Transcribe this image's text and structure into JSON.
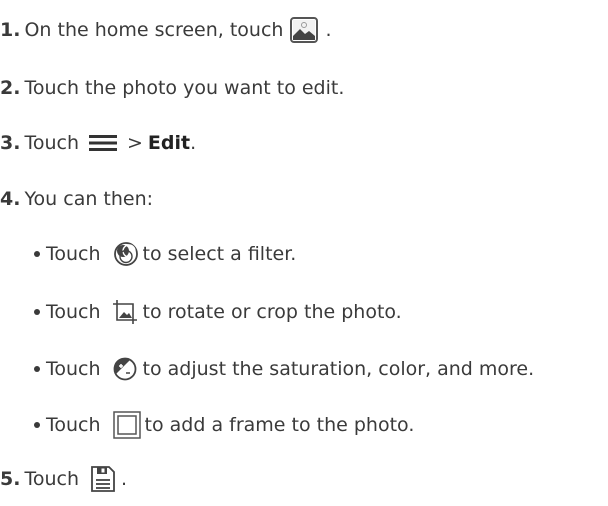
{
  "steps": [
    {
      "number": "1.",
      "pre": "On the home screen, touch",
      "post": "."
    },
    {
      "number": "2.",
      "text": "Touch the photo you want to edit."
    },
    {
      "number": "3.",
      "pre": "Touch",
      "mid": ">",
      "bold": "Edit",
      "post": "."
    },
    {
      "number": "4.",
      "text": "You can then:"
    },
    {
      "number": "5.",
      "pre": "Touch",
      "post": "."
    }
  ],
  "substeps": [
    {
      "pre": "Touch",
      "post": "to select a filter.",
      "icon": "filter-icon"
    },
    {
      "pre": "Touch",
      "post": "to rotate or crop the photo.",
      "icon": "crop-icon"
    },
    {
      "pre": "Touch",
      "post": "to adjust the saturation, color, and more.",
      "icon": "adjust-icon"
    },
    {
      "pre": "Touch",
      "post": "to add a frame to the photo.",
      "icon": "frame-icon"
    }
  ],
  "icons": {
    "step1": "gallery-icon",
    "step3": "menu-icon",
    "step5": "save-icon"
  }
}
